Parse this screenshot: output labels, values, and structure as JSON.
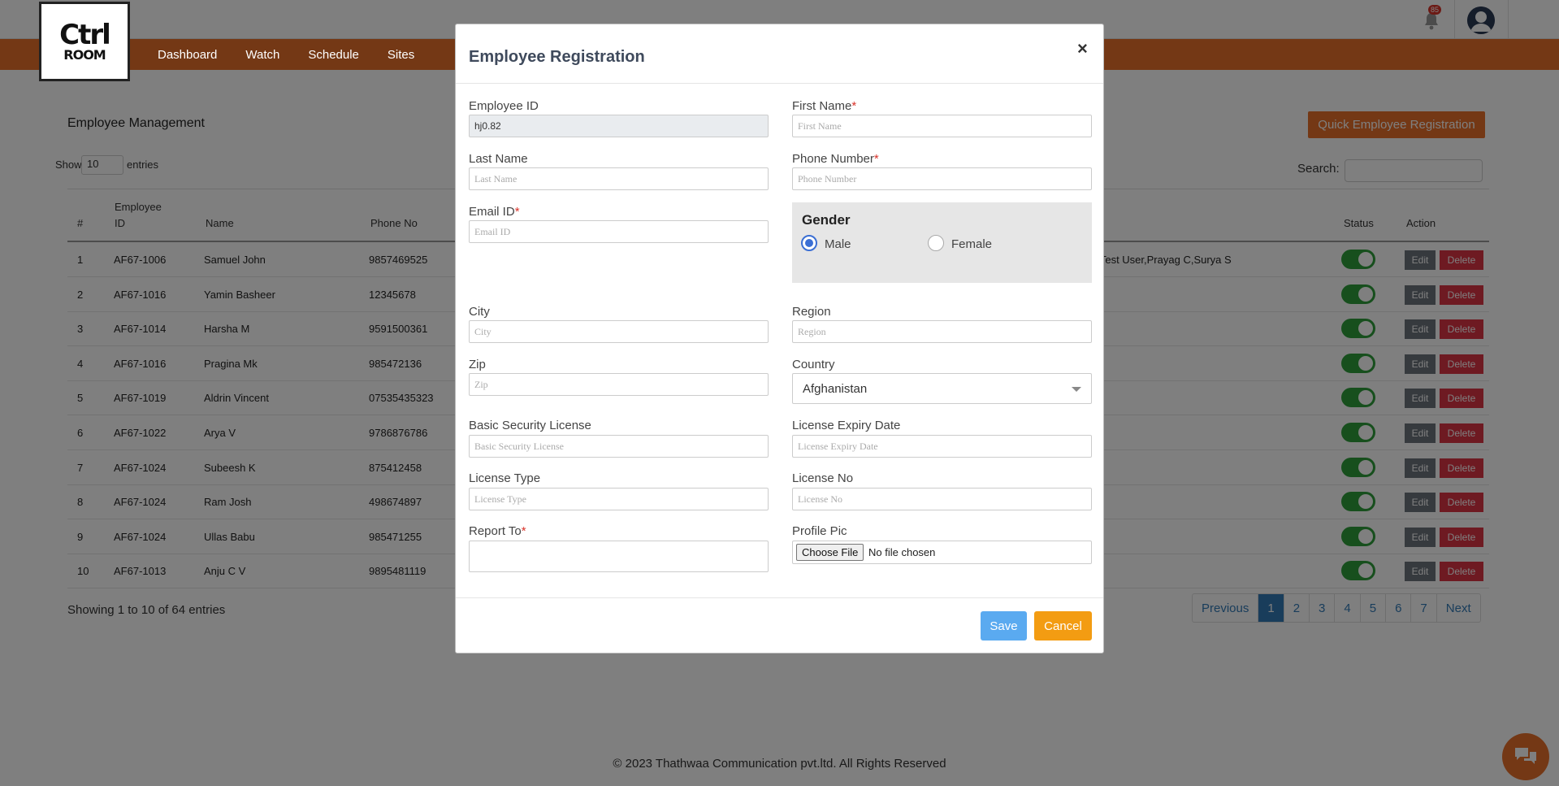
{
  "brand": {
    "logo_line1": "Ctrl",
    "logo_line2": "ROOM"
  },
  "nav": {
    "items": [
      "Dashboard",
      "Watch",
      "Schedule",
      "Sites"
    ]
  },
  "notifications": {
    "count": "85"
  },
  "page": {
    "title": "Employee Management",
    "quick_button": "Quick Employee Registration",
    "show_label": "Show",
    "show_value": "10",
    "entries_label": "entries",
    "search_label": "Search:"
  },
  "table": {
    "headers": {
      "num": "#",
      "emp_id_1": "Employee",
      "emp_id_2": "ID",
      "name": "Name",
      "phone": "Phone No",
      "status": "Status",
      "action": "Action"
    },
    "edit_label": "Edit",
    "delete_label": "Delete",
    "rows": [
      {
        "num": "1",
        "id": "AF67-1006",
        "name": "Samuel John",
        "phone": "9857469525",
        "extra": "a,Test User,Prayag C,Surya S"
      },
      {
        "num": "2",
        "id": "AF67-1016",
        "name": "Yamin Basheer",
        "phone": "12345678",
        "extra": ""
      },
      {
        "num": "3",
        "id": "AF67-1014",
        "name": "Harsha M",
        "phone": "9591500361",
        "extra": ""
      },
      {
        "num": "4",
        "id": "AF67-1016",
        "name": "Pragina Mk",
        "phone": "985472136",
        "extra": ""
      },
      {
        "num": "5",
        "id": "AF67-1019",
        "name": "Aldrin Vincent",
        "phone": "07535435323",
        "extra": ""
      },
      {
        "num": "6",
        "id": "AF67-1022",
        "name": "Arya V",
        "phone": "9786876786",
        "extra": ""
      },
      {
        "num": "7",
        "id": "AF67-1024",
        "name": "Subeesh K",
        "phone": "875412458",
        "extra": ""
      },
      {
        "num": "8",
        "id": "AF67-1024",
        "name": "Ram Josh",
        "phone": "498674897",
        "extra": ""
      },
      {
        "num": "9",
        "id": "AF67-1024",
        "name": "Ullas Babu",
        "phone": "985471255",
        "extra": ""
      },
      {
        "num": "10",
        "id": "AF67-1013",
        "name": "Anju C V",
        "phone": "9895481119",
        "extra": ""
      }
    ],
    "info": "Showing 1 to 10 of 64 entries",
    "pager": [
      "Previous",
      "1",
      "2",
      "3",
      "4",
      "5",
      "6",
      "7",
      "Next"
    ]
  },
  "footer": {
    "copyright": "© 2023 Thathwaa Communication pvt.ltd. All Rights Reserved"
  },
  "modal": {
    "title": "Employee Registration",
    "close": "×",
    "employee_id": {
      "label": "Employee ID",
      "value": "hj0.82"
    },
    "first_name": {
      "label": "First Name",
      "placeholder": "First Name"
    },
    "last_name": {
      "label": "Last Name",
      "placeholder": "Last Name"
    },
    "phone": {
      "label": "Phone Number",
      "placeholder": "Phone Number"
    },
    "email": {
      "label": "Email ID",
      "placeholder": "Email ID"
    },
    "gender": {
      "label": "Gender",
      "male": "Male",
      "female": "Female",
      "selected": "Male"
    },
    "city": {
      "label": "City",
      "placeholder": "City"
    },
    "region": {
      "label": "Region",
      "placeholder": "Region"
    },
    "zip": {
      "label": "Zip",
      "placeholder": "Zip"
    },
    "country": {
      "label": "Country",
      "value": "Afghanistan"
    },
    "security_license": {
      "label": "Basic Security License",
      "placeholder": "Basic Security License"
    },
    "license_expiry": {
      "label": "License Expiry Date",
      "placeholder": "License Expiry Date"
    },
    "license_type": {
      "label": "License Type",
      "placeholder": "License Type"
    },
    "license_no": {
      "label": "License No",
      "placeholder": "License No"
    },
    "report_to": {
      "label": "Report To"
    },
    "profile_pic": {
      "label": "Profile Pic",
      "button": "Choose File",
      "status": "No file chosen"
    },
    "required_mark": "*",
    "save": "Save",
    "cancel": "Cancel"
  },
  "colors": {
    "brand_orange": "#e8702a",
    "primary_blue": "#337ab7",
    "save_blue": "#5aaaf0",
    "cancel_orange": "#f39c12",
    "toggle_green": "#2e9e3b",
    "delete_red": "#dc3545"
  }
}
